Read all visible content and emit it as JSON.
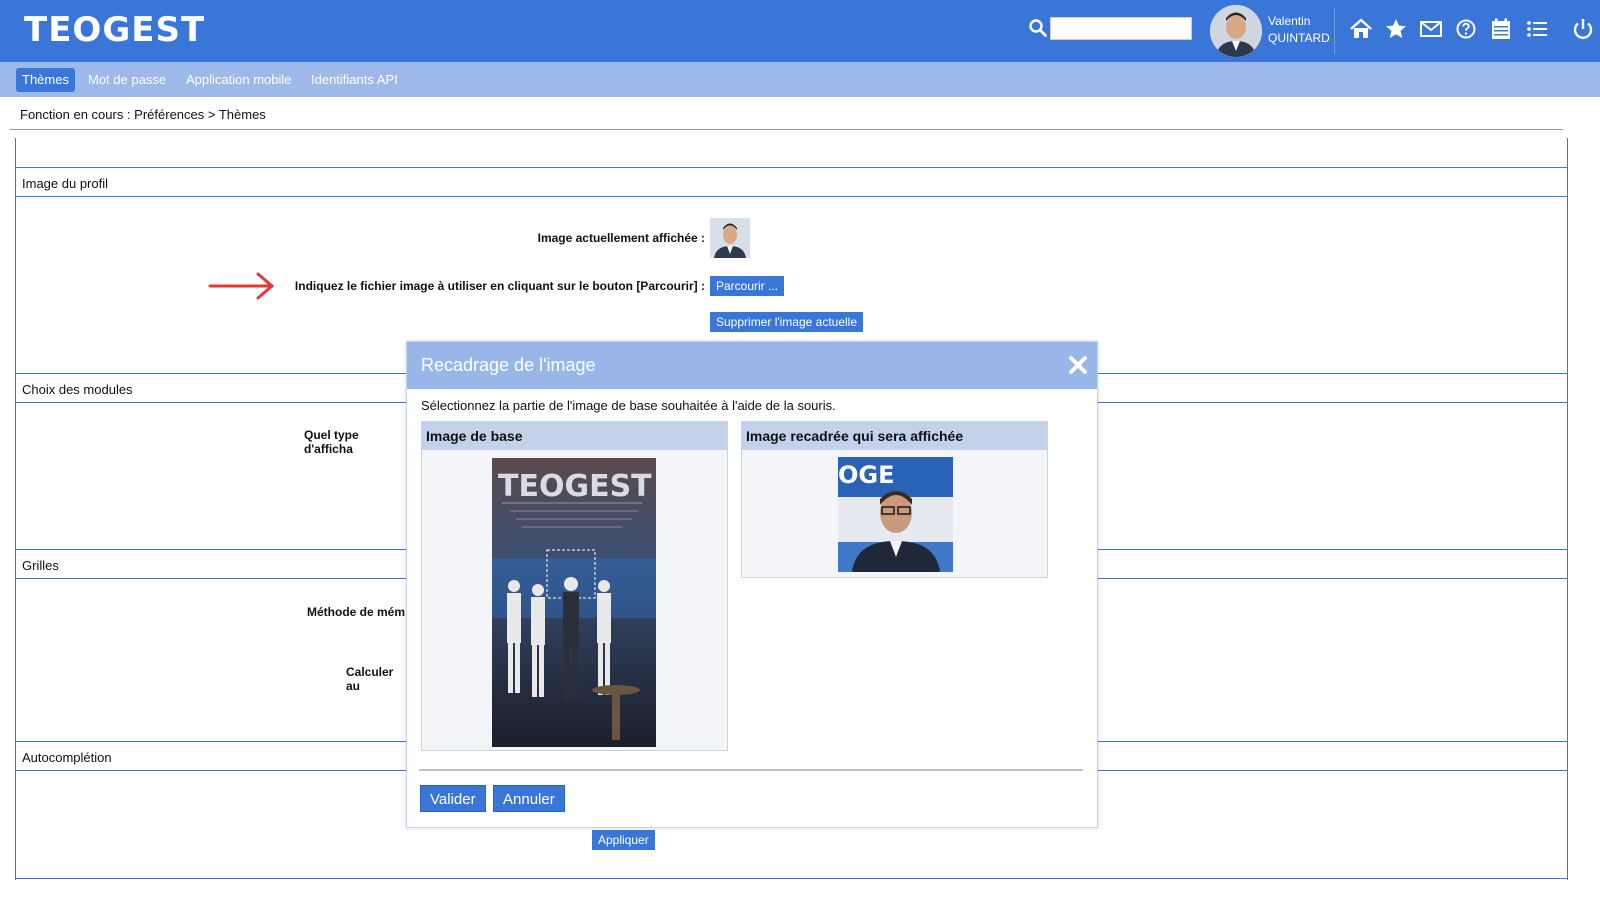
{
  "header": {
    "logo": "TEOGEST",
    "search_placeholder": "",
    "user_first": "Valentin",
    "user_last": "QUINTARD",
    "icons": [
      "search-icon",
      "home-icon",
      "star-icon",
      "mail-icon",
      "help-icon",
      "calendar-icon",
      "list-icon",
      "power-icon"
    ]
  },
  "tabs": [
    {
      "label": "Thèmes",
      "active": true
    },
    {
      "label": "Mot de passe",
      "active": false
    },
    {
      "label": "Application mobile",
      "active": false
    },
    {
      "label": "Identifiants API",
      "active": false
    }
  ],
  "breadcrumb": "Fonction en cours :  Préférences > Thèmes",
  "sections": {
    "profile": "Image du profil",
    "modules": "Choix des modules",
    "grids": "Grilles",
    "autocomplete": "Autocomplétion"
  },
  "profile": {
    "current_label": "Image actuellement affichée :",
    "file_label": "Indiquez le fichier image à utiliser en cliquant sur le bouton [Parcourir] :",
    "browse_button": "Parcourir ...",
    "delete_button": "Supprimer l'image actuelle"
  },
  "modules_label": "Quel type d'afficha",
  "grids_labels": {
    "memo": "Méthode de mém",
    "calc": "Calculer au"
  },
  "apply_button": "Appliquer",
  "modal": {
    "title": "Recadrage de l'image",
    "instruction": "Sélectionnez la partie de l'image de base souhaitée à l'aide de la souris.",
    "base_title": "Image de base",
    "cropped_title": "Image recadrée qui sera affichée",
    "validate": "Valider",
    "cancel": "Annuler"
  },
  "colors": {
    "primary": "#3a76d8",
    "subnav": "#9cb9ea",
    "modal_header": "#98b6e8",
    "arrow": "#e53935"
  }
}
